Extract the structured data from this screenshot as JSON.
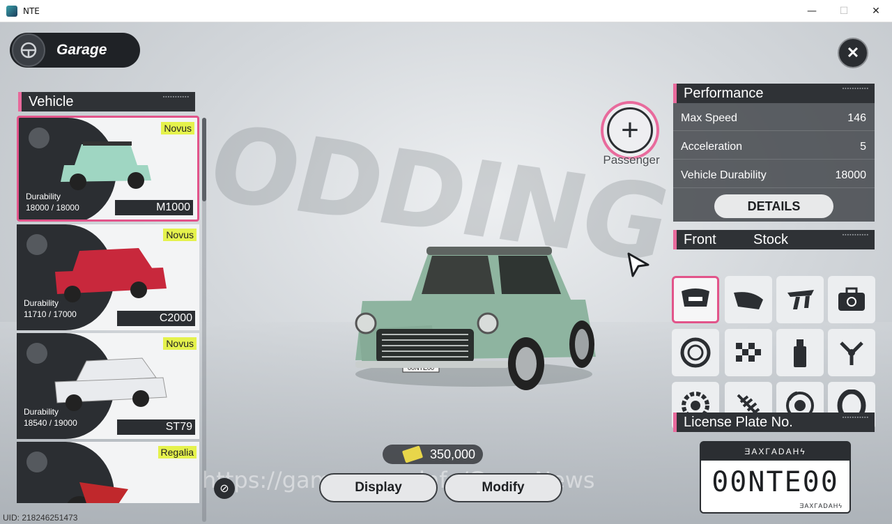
{
  "window": {
    "title": "NTE",
    "min": "—",
    "max": "☐",
    "close": "✕"
  },
  "header": {
    "garage_label": "Garage",
    "close_symbol": "✕"
  },
  "vehicle_panel": {
    "title": "Vehicle",
    "cards": [
      {
        "brand": "Novus",
        "durability_label": "Durability",
        "durability": "18000 / 18000",
        "model": "M1000",
        "color": "#9fd6c2",
        "selected": true
      },
      {
        "brand": "Novus",
        "durability_label": "Durability",
        "durability": "11710 / 17000",
        "model": "C2000",
        "color": "#c8283c",
        "selected": false
      },
      {
        "brand": "Novus",
        "durability_label": "Durability",
        "durability": "18540 / 19000",
        "model": "ST79",
        "color": "#e9ebee",
        "selected": false
      },
      {
        "brand": "Regalia",
        "durability_label": "",
        "durability": "",
        "model": "",
        "color": "#c0282c",
        "selected": false
      }
    ]
  },
  "passenger": {
    "label": "Passenger"
  },
  "performance": {
    "title": "Performance",
    "rows": [
      {
        "label": "Max Speed",
        "value": "146"
      },
      {
        "label": "Acceleration",
        "value": "5"
      },
      {
        "label": "Vehicle Durability",
        "value": "18000"
      }
    ],
    "details_label": "DETAILS"
  },
  "parts": {
    "title": "Front",
    "status": "Stock",
    "items": [
      "front-bumper-icon",
      "rear-bumper-icon",
      "spoiler-icon",
      "toolbox-icon",
      "wheel-rim-icon",
      "checkered-flag-icon",
      "spray-paint-icon",
      "engine-piston-icon",
      "gear-brake-icon",
      "suspension-spring-icon",
      "brake-disc-icon",
      "tire-icon"
    ]
  },
  "license_plate": {
    "title": "License Plate No.",
    "top_text": "ƎAXГADAHϟ",
    "number": "00NTE00",
    "bottom_text": "ƎAXГADAHϟ"
  },
  "bottom": {
    "currency": "350,000",
    "display_label": "Display",
    "modify_label": "Modify",
    "watermark": "https://gamernews.info/GameNews",
    "uid": "UID: 218246251473"
  },
  "scene": {
    "bg_text": "ODDING",
    "car_plate": "00NTE00"
  },
  "colors": {
    "accent_pink": "#e2548a",
    "highlight_yellow": "#e5f24c",
    "panel_dark": "#2f3236"
  }
}
